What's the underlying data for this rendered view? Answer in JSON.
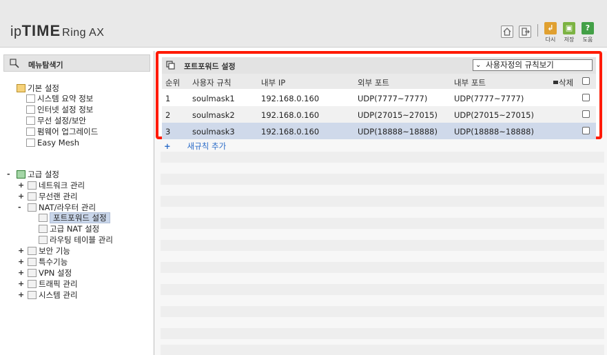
{
  "header": {
    "logo_ip": "ip",
    "logo_time": "TIME",
    "logo_model": "Ring AX",
    "buttons": [
      {
        "label": "다시",
        "color": "#e0a030"
      },
      {
        "label": "저장",
        "color": "#7cb342"
      },
      {
        "label": "도움",
        "color": "#43a047"
      }
    ],
    "home_icon": "home-icon",
    "logout_icon": "logout-icon"
  },
  "sidebar": {
    "header": "메뉴탐색기",
    "basic": {
      "label": "기본 설정",
      "items": [
        "시스템 요약 정보",
        "인터넷 설정 정보",
        "무선 설정/보안",
        "펌웨어 업그레이드",
        "Easy Mesh"
      ]
    },
    "advanced": {
      "label": "고급 설정",
      "items": [
        {
          "label": "네트워크 관리",
          "toggle": "+"
        },
        {
          "label": "무선랜 관리",
          "toggle": "+"
        },
        {
          "label": "NAT/라우터 관리",
          "toggle": "-"
        },
        {
          "label": "보안 기능",
          "toggle": "+"
        },
        {
          "label": "특수기능",
          "toggle": "+"
        },
        {
          "label": "VPN 설정",
          "toggle": "+"
        },
        {
          "label": "트래픽 관리",
          "toggle": "+"
        },
        {
          "label": "시스템 관리",
          "toggle": "+"
        }
      ],
      "nat_children": [
        "포트포워드 설정",
        "고급 NAT 설정",
        "라우팅 테이블 관리"
      ],
      "toggle": "-"
    }
  },
  "main": {
    "title": "포트포워드 설정",
    "view_select": "사용자정의 규칙보기",
    "columns": {
      "idx": "순위",
      "name": "사용자 규칙",
      "ip": "내부 IP",
      "ext": "외부 포트",
      "int": "내부 포트",
      "del": "삭제"
    },
    "rows": [
      {
        "idx": "1",
        "name": "soulmask1",
        "ip": "192.168.0.160",
        "ext": "UDP(7777~7777)",
        "int": "UDP(7777~7777)"
      },
      {
        "idx": "2",
        "name": "soulmask2",
        "ip": "192.168.0.160",
        "ext": "UDP(27015~27015)",
        "int": "UDP(27015~27015)"
      },
      {
        "idx": "3",
        "name": "soulmask3",
        "ip": "192.168.0.160",
        "ext": "UDP(18888~18888)",
        "int": "UDP(18888~18888)"
      }
    ],
    "add_label": "새규칙 추가",
    "add_symbol": "+",
    "highlight_color": "#ff1a00"
  }
}
